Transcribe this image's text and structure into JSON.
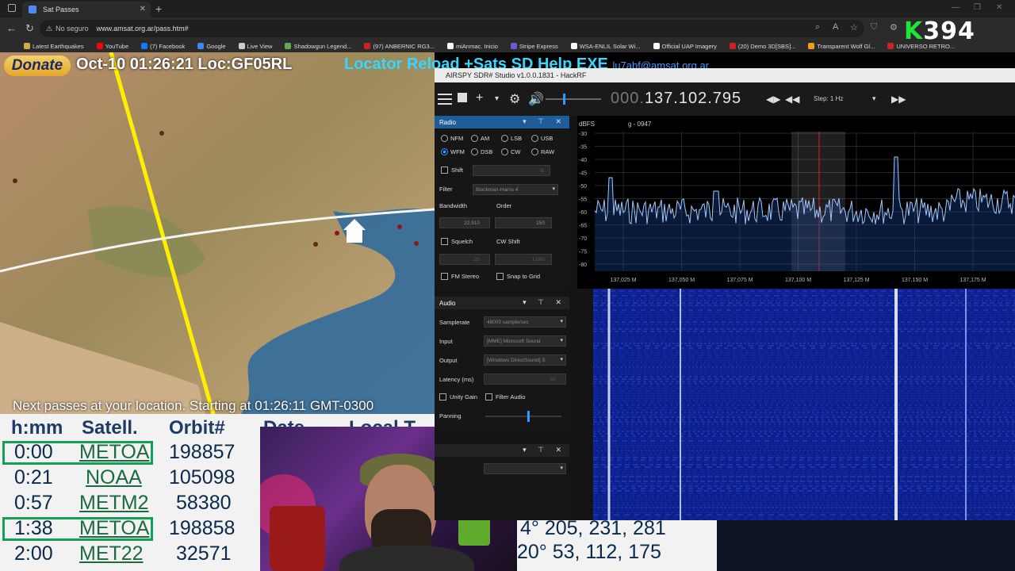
{
  "browser": {
    "tab_title": "Sat Passes",
    "url": "www.amsat.org.ar/pass.htm#",
    "security": "No seguro",
    "bookmarks": [
      "Latest Earthquakes",
      "YouTube",
      "(7) Facebook",
      "Google",
      "Live View",
      "Shadowgun Legend...",
      "(97) ANBERNIC RG3...",
      "miAnmac. Inicio",
      "Stripe Express",
      "WSA-ENLIL Solar Wi...",
      "Official UAP Imagery",
      "(20) Demo 3D[SBS]...",
      "Transparent Wolf Gl...",
      "UNIVERSO RETRO..."
    ],
    "bookmark_colors": [
      "#d4a84a",
      "#ff0000",
      "#1877f2",
      "#4285f4",
      "#cccccc",
      "#6aa84f",
      "#cc2222",
      "#ffffff",
      "#6a5acd",
      "#ffffff",
      "#ffffff",
      "#cc2222",
      "#f39c12",
      "#cc2222"
    ],
    "logo_letter": "K",
    "logo_number": "394"
  },
  "page": {
    "donate": "Donate",
    "datetime_loc": "Oct-10 01:26:21   Loc:GF05RL",
    "menu": "Locator Reload +Sats SD Help EXE",
    "email": "lu7abf@amsat.org.ar",
    "next_passes": "Next passes at your location. Starting at 01:26:11 GMT-0300",
    "table_headers": [
      "h:mm",
      "Satell.",
      "Orbit#",
      "Date",
      "Local T"
    ],
    "rows": [
      {
        "time": "0:00",
        "sat": "METOA",
        "orbit": "198857",
        "highlight": true
      },
      {
        "time": "0:21",
        "sat": "NOAA",
        "orbit": "105098",
        "highlight": false
      },
      {
        "time": "0:57",
        "sat": "METM2",
        "orbit": "58380",
        "highlight": false
      },
      {
        "time": "1:38",
        "sat": "METOA",
        "orbit": "198858",
        "highlight": true
      },
      {
        "time": "2:00",
        "sat": "MET22",
        "orbit": "32571",
        "highlight": false
      }
    ],
    "tail_values": [
      "4°   205, 231, 281",
      "20°   53, 112, 175"
    ]
  },
  "sdr": {
    "title": "AIRSPY SDR# Studio v1.0.0.1831 - HackRF",
    "freq_dim": "000.",
    "freq": "137.102.795",
    "step": "Step: 1 Hz",
    "radio": {
      "header": "Radio",
      "modes": [
        "NFM",
        "AM",
        "LSB",
        "USB",
        "WFM",
        "DSB",
        "CW",
        "RAW"
      ],
      "selected": "WFM",
      "shift": "Shift",
      "shift_val": "0",
      "filter": "Filter",
      "filter_val": "Blackman-Harris 4",
      "bandwidth": "Bandwidth",
      "bandwidth_val": "22,910",
      "order": "Order",
      "order_val": "250",
      "squelch": "Squelch",
      "cw_shift": "CW Shift",
      "squelch_val": "20",
      "cw_val": "1,000",
      "fm_stereo": "FM Stereo",
      "snap": "Snap to Grid"
    },
    "audio": {
      "header": "Audio",
      "samplerate": "Samplerate",
      "samplerate_val": "48000 sample/sec",
      "input": "Input",
      "input_val": "[MME] Microsoft Sound",
      "output": "Output",
      "output_val": "[Windows DirectSound] S",
      "latency": "Latency (ms)",
      "latency_val": "50",
      "unity": "Unity Gain",
      "filter_audio": "Filter Audio",
      "panning": "Panning",
      "panning_level": 0.55
    },
    "spectrum": {
      "unit": "dBFS",
      "marker": "g - 0947",
      "y_ticks": [
        "-30",
        "-35",
        "-40",
        "-45",
        "-50",
        "-55",
        "-60",
        "-65",
        "-70",
        "-75",
        "-80"
      ],
      "x_ticks": [
        "137,025 M",
        "137,050 M",
        "137,075 M",
        "137,100 M",
        "137,125 M",
        "137,150 M",
        "137,175 M"
      ]
    }
  }
}
